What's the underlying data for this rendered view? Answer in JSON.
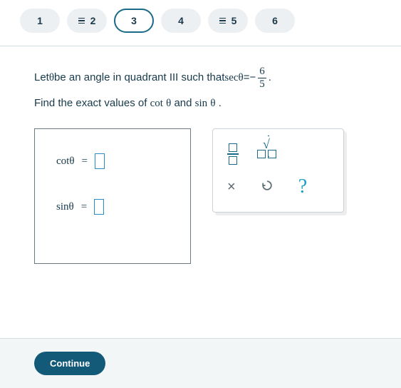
{
  "tabs": {
    "items": [
      {
        "label": "1",
        "marked": false
      },
      {
        "label": "2",
        "marked": true
      },
      {
        "label": "3",
        "marked": false
      },
      {
        "label": "4",
        "marked": false
      },
      {
        "label": "5",
        "marked": true
      },
      {
        "label": "6",
        "marked": false
      }
    ],
    "active_index": 2
  },
  "problem": {
    "prefix": "Let ",
    "theta": "θ",
    "mid1": " be an angle in quadrant III such that ",
    "sec_label": "sec",
    "eq": " = ",
    "minus": "−",
    "frac_num": "6",
    "frac_den": "5",
    "period": ".",
    "line2_a": "Find the exact values of ",
    "cot_label": "cot",
    "and": " and ",
    "sin_label": "sin"
  },
  "answers": {
    "cot": {
      "fn": "cot",
      "theta": "θ",
      "eq": "="
    },
    "sin": {
      "fn": "sin",
      "theta": "θ",
      "eq": "="
    }
  },
  "toolpad": {
    "x_label": "×",
    "help_label": "?"
  },
  "footer": {
    "continue": "Continue"
  }
}
